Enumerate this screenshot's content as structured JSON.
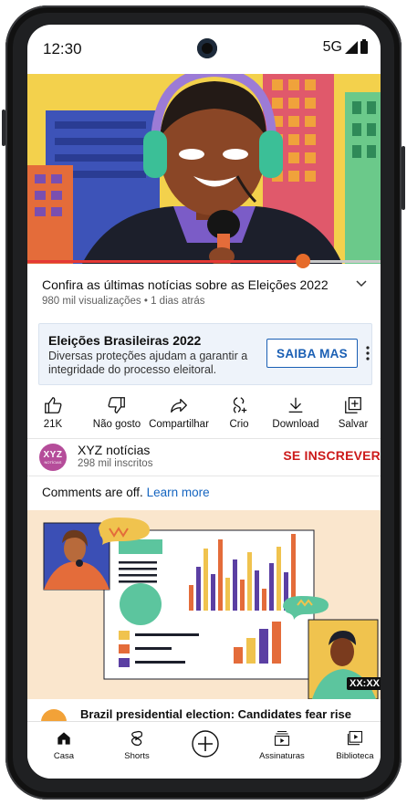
{
  "status_bar": {
    "time": "12:30",
    "network": "5G"
  },
  "video": {
    "title": "Confira as últimas notícias sobre as Eleições 2022",
    "meta": "980 mil visualizações • 1 dias atrás",
    "progress": 0.78
  },
  "ad": {
    "title": "Eleições Brasileiras 2022",
    "description": "Diversas proteções ajudam a garantir a integridade do processo eleitoral.",
    "button": "SAIBA MAS"
  },
  "actions": [
    {
      "label": "21K",
      "icon": "thumb-up-icon"
    },
    {
      "label": "Não gosto",
      "icon": "thumb-down-icon"
    },
    {
      "label": "Compartilhar",
      "icon": "share-icon"
    },
    {
      "label": "Crio",
      "icon": "remix-icon"
    },
    {
      "label": "Download",
      "icon": "download-icon"
    },
    {
      "label": "Salvar",
      "icon": "save-icon"
    }
  ],
  "channel": {
    "avatar_text": "XYZ",
    "avatar_subtext": "NOTÍCIAS",
    "name": "XYZ notícias",
    "subscribers": "298 mil inscritos",
    "subscribe": "SE INSCREVER"
  },
  "comments": {
    "text": "Comments are off.",
    "link": "Learn more"
  },
  "next_video": {
    "duration": "XX:XX",
    "title": "Brazil presidential election: Candidates fear rise"
  },
  "nav": [
    {
      "label": "Casa",
      "icon": "home-icon"
    },
    {
      "label": "Shorts",
      "icon": "shorts-icon"
    },
    {
      "label": "",
      "icon": "create-icon"
    },
    {
      "label": "Assinaturas",
      "icon": "subscriptions-icon"
    },
    {
      "label": "Biblioteca",
      "icon": "library-icon"
    }
  ],
  "colors": {
    "subscribe": "#cc1a1a",
    "link": "#1565c0",
    "progress": "#e53935"
  }
}
